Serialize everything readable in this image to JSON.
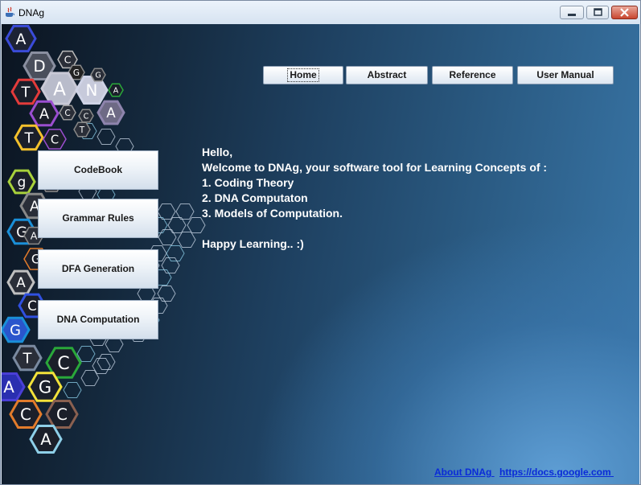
{
  "window": {
    "title": "DNAg",
    "controls": [
      "minimize-icon",
      "maximize-icon",
      "close-icon"
    ]
  },
  "logo": {
    "hex_letters": [
      "A",
      "D",
      "C",
      "G",
      "T",
      "A",
      "N",
      "A",
      "C",
      "C",
      "T",
      "A",
      "C",
      "g",
      "A",
      "G",
      "G",
      "A",
      "C",
      "G",
      "T",
      "C",
      "A",
      "G",
      "C",
      "C",
      "A",
      "T",
      "A",
      "G",
      "T",
      "A"
    ]
  },
  "nav": {
    "home": "Home",
    "abstract": "Abstract",
    "reference": "Reference",
    "user_manual": "User Manual"
  },
  "sidebar": {
    "codebook": "CodeBook",
    "grammar_rules": "Grammar Rules",
    "dfa_generation": "DFA Generation",
    "dna_computation": "DNA Computation"
  },
  "welcome": {
    "line1": "Hello,",
    "line2": "Welcome to DNAg, your software tool for Learning Concepts of :",
    "line3": "1. Coding Theory",
    "line4": "2. DNA Computaton",
    "line5": "3. Models of Computation.",
    "line6": "Happy Learning.. :)"
  },
  "footer": {
    "about": "About DNAg ",
    "docs": "https://docs.google.com "
  }
}
